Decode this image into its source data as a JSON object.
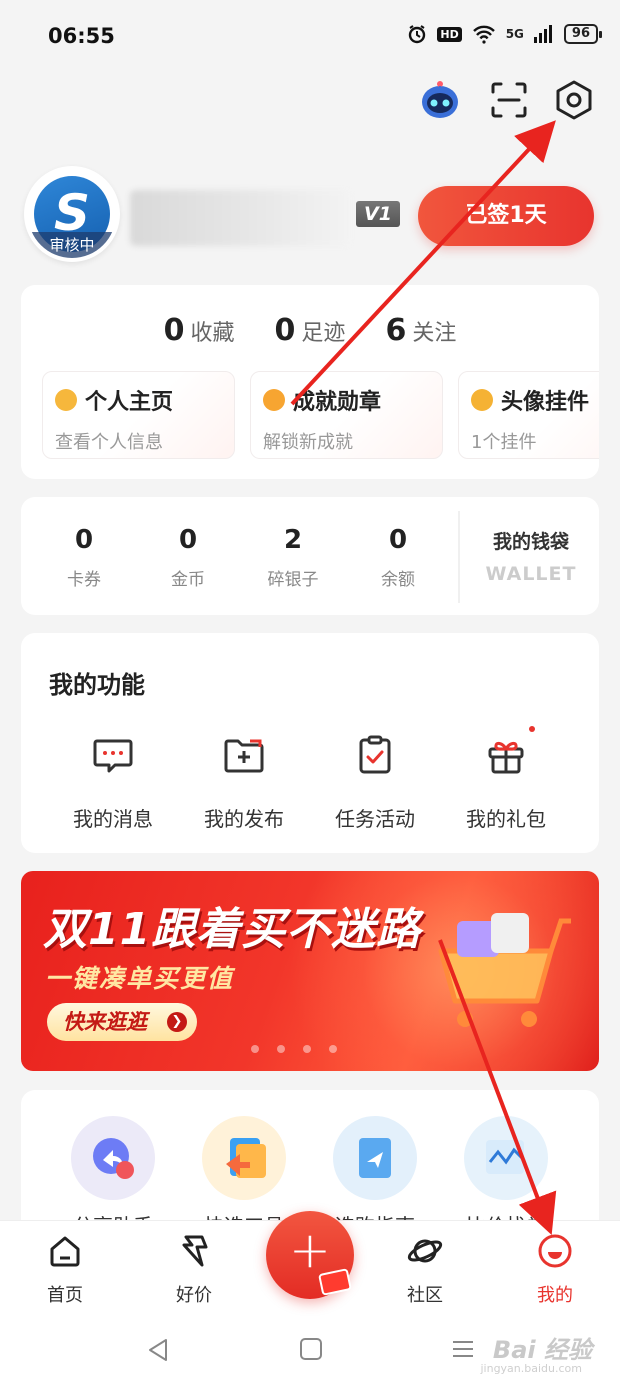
{
  "status_bar": {
    "time": "06:55",
    "hd": "HD",
    "network": "5G",
    "battery": "96"
  },
  "header": {
    "icons": [
      "robot-assistant-icon",
      "scan-icon",
      "settings-icon"
    ]
  },
  "profile": {
    "avatar_letter": "S",
    "avatar_badge": "审核中",
    "level": "V1",
    "checkin_label": "已签1天"
  },
  "stats": [
    {
      "num": "0",
      "label": "收藏"
    },
    {
      "num": "0",
      "label": "足迹"
    },
    {
      "num": "6",
      "label": "关注"
    }
  ],
  "features": [
    {
      "title": "个人主页",
      "sub": "查看个人信息",
      "icon_color": "#f6b73c"
    },
    {
      "title": "成就勋章",
      "sub": "解锁新成就",
      "icon_color": "#f7a531"
    },
    {
      "title": "头像挂件",
      "sub": "1个挂件",
      "icon_color": "#f5b234"
    }
  ],
  "wallet": {
    "items": [
      {
        "num": "0",
        "label": "卡券"
      },
      {
        "num": "0",
        "label": "金币"
      },
      {
        "num": "2",
        "label": "碎银子"
      },
      {
        "num": "0",
        "label": "余额"
      }
    ],
    "title": "我的钱袋",
    "subtitle": "WALLET"
  },
  "functions": {
    "title": "我的功能",
    "items": [
      {
        "label": "我的消息",
        "icon": "message-icon"
      },
      {
        "label": "我的发布",
        "icon": "folder-add-icon"
      },
      {
        "label": "任务活动",
        "icon": "clipboard-check-icon"
      },
      {
        "label": "我的礼包",
        "icon": "gift-icon"
      }
    ]
  },
  "banner": {
    "title": "双11跟着买不迷路",
    "subtitle": "一键凑单买更值",
    "button": "快来逛逛",
    "button_arrow": "❯"
  },
  "tools": [
    {
      "label": "分享助手",
      "bg": "#eceaf8"
    },
    {
      "label": "快选工具",
      "bg": "#fff2d9"
    },
    {
      "label": "选购指南",
      "bg": "#e3f0fb"
    },
    {
      "label": "比价找券",
      "bg": "#e6f2fb"
    }
  ],
  "bottom_nav": [
    {
      "label": "首页",
      "icon": "home-icon"
    },
    {
      "label": "好价",
      "icon": "deal-icon"
    },
    {
      "label": "社区",
      "icon": "planet-icon"
    },
    {
      "label": "我的",
      "icon": "profile-icon",
      "active": true
    }
  ],
  "publish_plus": "+",
  "watermark": {
    "main": "Bai 经验",
    "sub": "jingyan.baidu.com"
  },
  "colors": {
    "accent": "#e8342e",
    "background": "#f4f4f4"
  }
}
